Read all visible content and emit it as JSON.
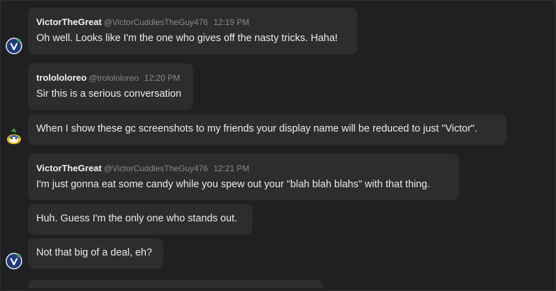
{
  "messages": [
    {
      "name": "VictorTheGreat",
      "handle": "@VictorCuddlesTheGuy476",
      "time": "12:19 PM",
      "text": "Oh well. Looks like I'm the one who gives off the nasty tricks. Haha!"
    },
    {
      "name": "trolololoreo",
      "handle": "@trolololoreo",
      "time": "12:20 PM",
      "text": "Sir this is a serious conversation"
    },
    {
      "text": "When I show these gc screenshots to my friends your display name will be reduced to just \"Victor\"."
    },
    {
      "name": "VictorTheGreat",
      "handle": "@VictorCuddlesTheGuy476",
      "time": "12:21 PM",
      "text": "I'm just gonna eat some candy while you spew out your \"blah blah blahs\" with that thing."
    },
    {
      "text": "Huh. Guess I'm the only one who stands out."
    },
    {
      "text": "Not that big of a deal, eh?"
    }
  ],
  "avatars": {
    "victor": "victor-v-logo-icon",
    "troll": "cartoon-character-icon"
  },
  "colors": {
    "background": "#202022",
    "bubble": "#2d2d30",
    "victor_avatar": "#1e3a7a"
  }
}
